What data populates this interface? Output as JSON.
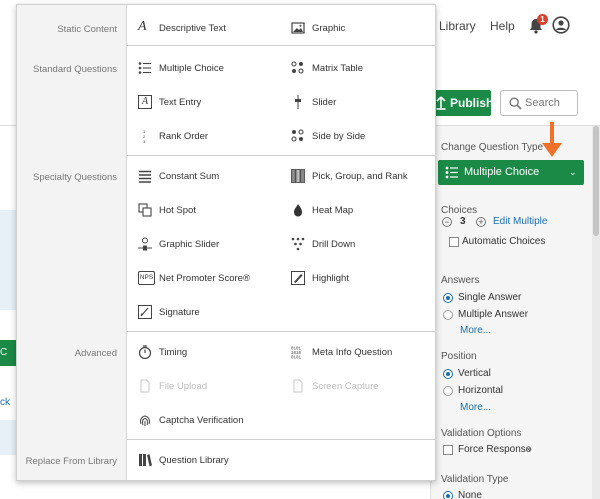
{
  "topnav": {
    "library": "Library",
    "help": "Help",
    "notification_count": "1"
  },
  "toolbar": {
    "publish": "Publish",
    "search_placeholder": "Search"
  },
  "left": {
    "green_button_fragment": "C",
    "link_fragment": "ck"
  },
  "menu": {
    "categories": {
      "static": "Static Content",
      "standard": "Standard Questions",
      "specialty": "Specialty Questions",
      "advanced": "Advanced",
      "replace": "Replace From Library"
    },
    "items": {
      "descriptive_text": "Descriptive Text",
      "graphic": "Graphic",
      "multiple_choice": "Multiple Choice",
      "matrix_table": "Matrix Table",
      "text_entry": "Text Entry",
      "slider": "Slider",
      "rank_order": "Rank Order",
      "side_by_side": "Side by Side",
      "constant_sum": "Constant Sum",
      "pick_group_rank": "Pick, Group, and Rank",
      "hot_spot": "Hot Spot",
      "heat_map": "Heat Map",
      "graphic_slider": "Graphic Slider",
      "drill_down": "Drill Down",
      "nps": "Net Promoter Score®",
      "highlight": "Highlight",
      "signature": "Signature",
      "timing": "Timing",
      "meta_info": "Meta Info Question",
      "file_upload": "File Upload",
      "screen_capture": "Screen Capture",
      "captcha": "Captcha Verification",
      "question_library": "Question Library"
    },
    "icon_text": {
      "nps": "NPS",
      "text_entry": "A",
      "descriptive": "A"
    }
  },
  "panel": {
    "change_question_type": "Change Question Type",
    "selected_type": "Multiple Choice",
    "choices_label": "Choices",
    "choices_count": "3",
    "edit_multiple": "Edit Multiple",
    "automatic_choices": "Automatic Choices",
    "answers_label": "Answers",
    "single_answer": "Single Answer",
    "multiple_answer": "Multiple Answer",
    "more1": "More...",
    "position_label": "Position",
    "vertical": "Vertical",
    "horizontal": "Horizontal",
    "more2": "More...",
    "validation_options": "Validation Options",
    "force_response": "Force Response",
    "validation_type": "Validation Type",
    "none": "None"
  },
  "colors": {
    "green": "#1a8a46",
    "link_blue": "#1a6fb0",
    "arrow_orange": "#f0712c",
    "badge_red": "#d9412b"
  }
}
